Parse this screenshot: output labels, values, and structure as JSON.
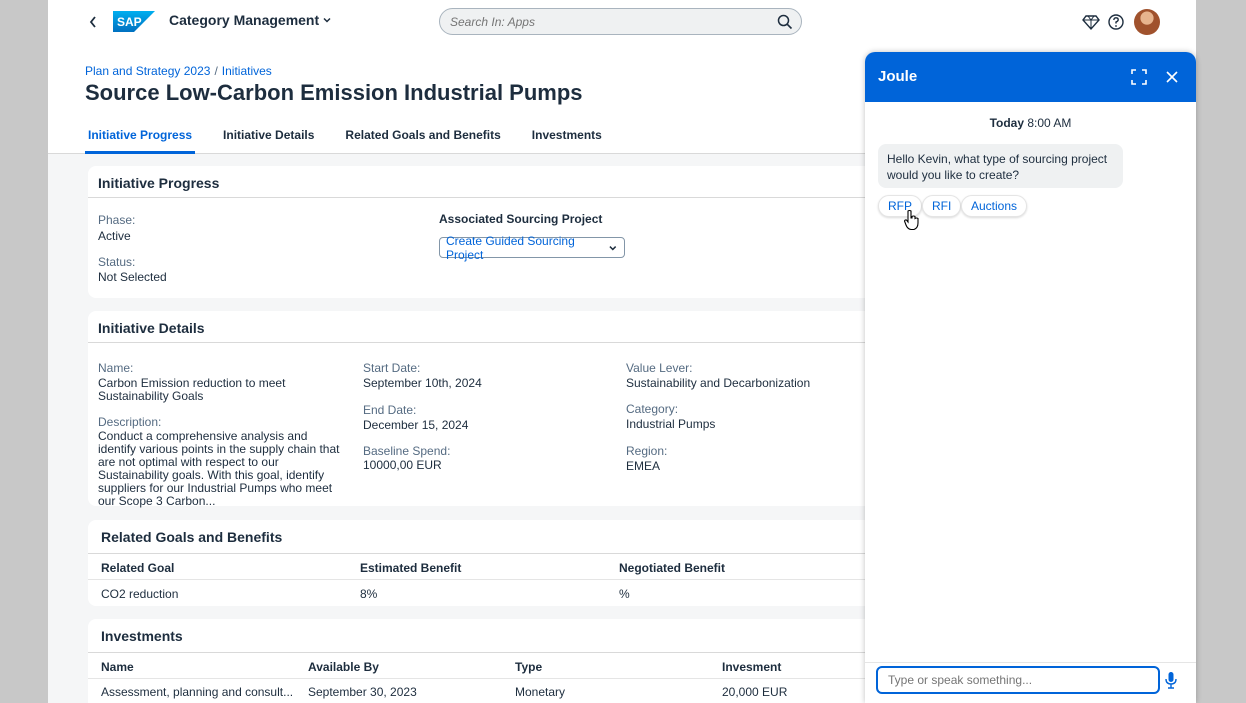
{
  "shell": {
    "logo_text": "SAP",
    "app_title": "Category Management",
    "search_placeholder": "Search In: Apps"
  },
  "header": {
    "breadcrumb": [
      "Plan and Strategy 2023",
      "Initiatives"
    ],
    "breadcrumb_sep": "/",
    "title": "Source Low-Carbon Emission Industrial Pumps",
    "tabs": [
      "Initiative Progress",
      "Initiative Details",
      "Related Goals and Benefits",
      "Investments"
    ],
    "active_tab": "Initiative Progress"
  },
  "progress": {
    "title": "Initiative Progress",
    "phase_label": "Phase:",
    "phase_value": "Active",
    "status_label": "Status:",
    "status_value": "Not Selected",
    "assoc_label": "Associated Sourcing Project",
    "assoc_button": "Create Guided Sourcing Project"
  },
  "details": {
    "title": "Initiative Details",
    "name_label": "Name:",
    "name_value": "Carbon Emission reduction to meet Sustainability Goals",
    "desc_label": "Description:",
    "desc_value": "Conduct a comprehensive analysis and identify various points in the supply chain that are not optimal with respect to our Sustainability goals. With this goal, identify suppliers for our Industrial Pumps who meet our Scope 3 Carbon...",
    "start_label": "Start Date:",
    "start_value": "September 10th, 2024",
    "end_label": "End Date:",
    "end_value": "December 15, 2024",
    "baseline_label": "Baseline Spend:",
    "baseline_value": "10000,00 EUR",
    "lever_label": "Value Lever:",
    "lever_value": "Sustainability and Decarbonization",
    "category_label": "Category:",
    "category_value": "Industrial Pumps",
    "region_label": "Region:",
    "region_value": "EMEA"
  },
  "goals": {
    "title": "Related Goals and Benefits",
    "columns": [
      "Related Goal",
      "Estimated Benefit",
      "Negotiated Benefit"
    ],
    "rows": [
      [
        "CO2 reduction",
        "8%",
        "%"
      ]
    ]
  },
  "investments": {
    "title": "Investments",
    "columns": [
      "Name",
      "Available By",
      "Type",
      "Invesment"
    ],
    "rows": [
      [
        "Assessment, planning and consult...",
        "September 30, 2023",
        "Monetary",
        "20,000 EUR"
      ]
    ]
  },
  "joule": {
    "title": "Joule",
    "timestamp_day": "Today",
    "timestamp_time": "8:00 AM",
    "message": "Hello Kevin, what type of sourcing project would you like to create?",
    "options": [
      "RFP",
      "RFI",
      "Auctions"
    ],
    "input_placeholder": "Type or speak something..."
  },
  "colors": {
    "brand_blue": "#0064d9",
    "text": "#1d2d3e",
    "label": "#556b82"
  }
}
